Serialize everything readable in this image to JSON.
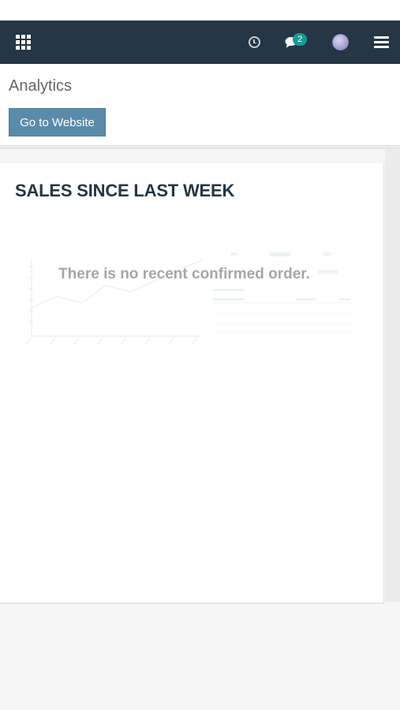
{
  "navbar": {
    "apps_icon": "apps-grid-icon",
    "activity_icon": "clock-icon",
    "messages_icon": "chat-icon",
    "messages_count": "2",
    "avatar_icon": "user-avatar",
    "menu_icon": "hamburger-icon",
    "colors": {
      "background": "#253644",
      "badge": "#159d92"
    }
  },
  "control_panel": {
    "title": "Analytics",
    "go_to_website_label": "Go to Website",
    "button_color": "#5b8baa"
  },
  "dashboard": {
    "card_title": "SALES SINCE LAST WEEK",
    "empty_message": "There is no recent confirmed order."
  }
}
